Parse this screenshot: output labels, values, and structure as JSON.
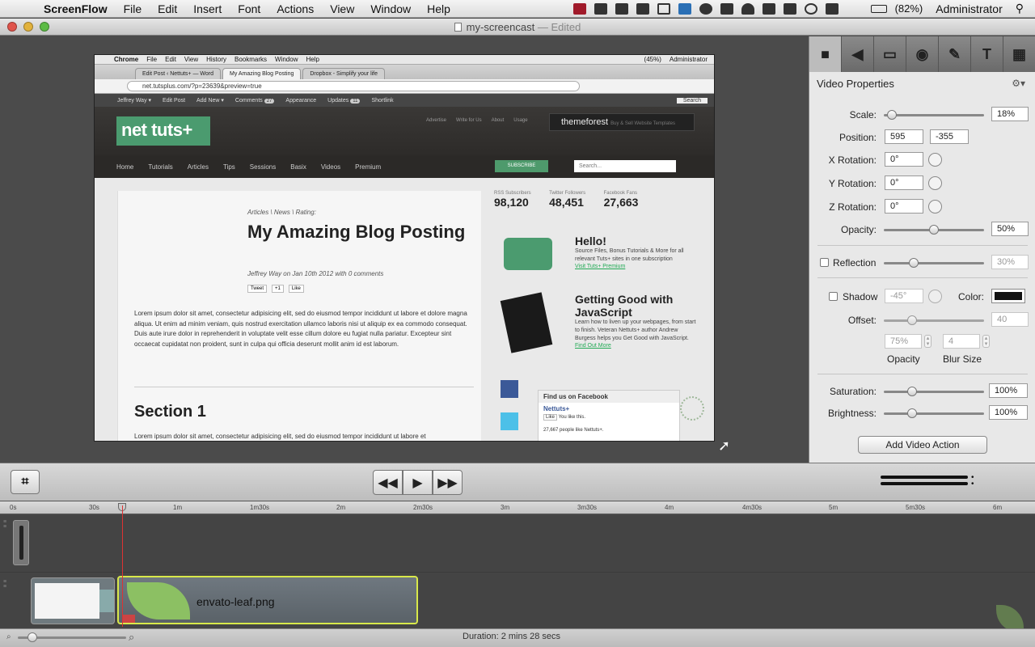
{
  "menubar": {
    "app_name": "ScreenFlow",
    "items": [
      "File",
      "Edit",
      "Insert",
      "Font",
      "Actions",
      "View",
      "Window",
      "Help"
    ],
    "battery": "(82%)",
    "user": "Administrator"
  },
  "window": {
    "title": "my-screencast",
    "edited": "— Edited"
  },
  "preview": {
    "menubar": {
      "app": "Chrome",
      "items": [
        "File",
        "Edit",
        "View",
        "History",
        "Bookmarks",
        "Window",
        "Help"
      ],
      "battery": "(45%)",
      "user": "Administrator"
    },
    "tabs": [
      "Edit Post ‹ Nettuts+ — Word",
      "My Amazing Blog Posting",
      "Dropbox - Simplify your life"
    ],
    "url": "net.tutsplus.com/?p=23639&preview=true",
    "adminbar": {
      "items": [
        "Jeffrey Way ▾",
        "Edit Post",
        "Add New ▾",
        "Comments",
        "Appearance",
        "Updates",
        "Shortlink"
      ],
      "comments_count": "27",
      "updates_count": "11",
      "search": "Search"
    },
    "logo": "net tuts+",
    "header_links": [
      "Advertise",
      "Write for Us",
      "About",
      "Usage"
    ],
    "themeforest": "themeforest",
    "themeforest_tag": "Buy & Sell Website Templates",
    "nav": [
      "Home",
      "Tutorials",
      "Articles",
      "Tips",
      "Sessions",
      "Basix",
      "Videos",
      "Premium"
    ],
    "subscribe": "SUBSCRIBE",
    "search_placeholder": "Search...",
    "post": {
      "meta": "Articles \\ News \\ Rating:",
      "title": "My Amazing Blog Posting",
      "byline": "Jeffrey Way on Jan 10th 2012 with 0 comments",
      "share": [
        "Tweet",
        "+1",
        "Like"
      ],
      "lorem": "Lorem ipsum dolor sit amet, consectetur adipisicing elit, sed do eiusmod tempor incididunt ut labore et dolore magna aliqua. Ut enim ad minim veniam, quis nostrud exercitation ullamco laboris nisi ut aliquip ex ea commodo consequat. Duis aute irure dolor in reprehenderit in voluptate velit esse cillum dolore eu fugiat nulla pariatur. Excepteur sint occaecat cupidatat non proident, sunt in culpa qui officia deserunt mollit anim id est laborum.",
      "section": "Section 1",
      "lorem2": "Lorem ipsum dolor sit amet, consectetur adipisicing elit, sed do eiusmod tempor incididunt ut labore et"
    },
    "sidebar": {
      "stats": [
        {
          "label": "RSS Subscribers",
          "value": "98,120"
        },
        {
          "label": "Twitter Followers",
          "value": "48,451"
        },
        {
          "label": "Facebook Fans",
          "value": "27,663"
        }
      ],
      "promo1": {
        "title": "Hello!",
        "text": "Source Files, Bonus Tutorials & More for all relevant Tuts+ sites in one subscription",
        "link": "Visit Tuts+ Premium"
      },
      "promo2": {
        "title": "Getting Good with JavaScript",
        "text": "Learn how to liven up your webpages, from start to finish. Veteran Nettuts+ author Andrew Burgess helps you Get Good with JavaScript.",
        "link": "Find Out More"
      },
      "facebook": {
        "title": "Find us on Facebook",
        "page": "Nettuts+",
        "like": "Like",
        "you_like": "You like this.",
        "people": "27,667 people like Nettuts+."
      }
    }
  },
  "inspector": {
    "title": "Video Properties",
    "scale": {
      "label": "Scale:",
      "value": "18%",
      "level": 0.08
    },
    "position": {
      "label": "Position:",
      "x": "595",
      "y": "-355"
    },
    "x_rotation": {
      "label": "X Rotation:",
      "value": "0°"
    },
    "y_rotation": {
      "label": "Y Rotation:",
      "value": "0°"
    },
    "z_rotation": {
      "label": "Z Rotation:",
      "value": "0°"
    },
    "opacity": {
      "label": "Opacity:",
      "value": "50%",
      "level": 0.5
    },
    "reflection": {
      "label": "Reflection",
      "value": "30%",
      "level": 0.3,
      "checked": false
    },
    "shadow": {
      "label": "Shadow",
      "angle": "-45°",
      "color_label": "Color:",
      "color": "#111111",
      "checked": false
    },
    "offset": {
      "label": "Offset:",
      "value": "40",
      "level": 0.28
    },
    "shadow_opacity": {
      "value": "75%",
      "label": "Opacity"
    },
    "blur": {
      "value": "4",
      "label": "Blur Size"
    },
    "saturation": {
      "label": "Saturation:",
      "value": "100%",
      "level": 0.28
    },
    "brightness": {
      "label": "Brightness:",
      "value": "100%",
      "level": 0.28
    },
    "add_action": "Add Video Action"
  },
  "timeline": {
    "ticks": [
      "0s",
      "30s",
      "1m",
      "1m30s",
      "2m",
      "2m30s",
      "3m",
      "3m30s",
      "4m",
      "4m30s",
      "5m",
      "5m30s",
      "6m"
    ],
    "clip_name": "envato-leaf.png",
    "duration": "Duration: 2 mins 28 secs"
  },
  "colors": {
    "accent": "#d8e84a",
    "playhead": "#dd3333",
    "brand_green": "#4b9b6f"
  }
}
